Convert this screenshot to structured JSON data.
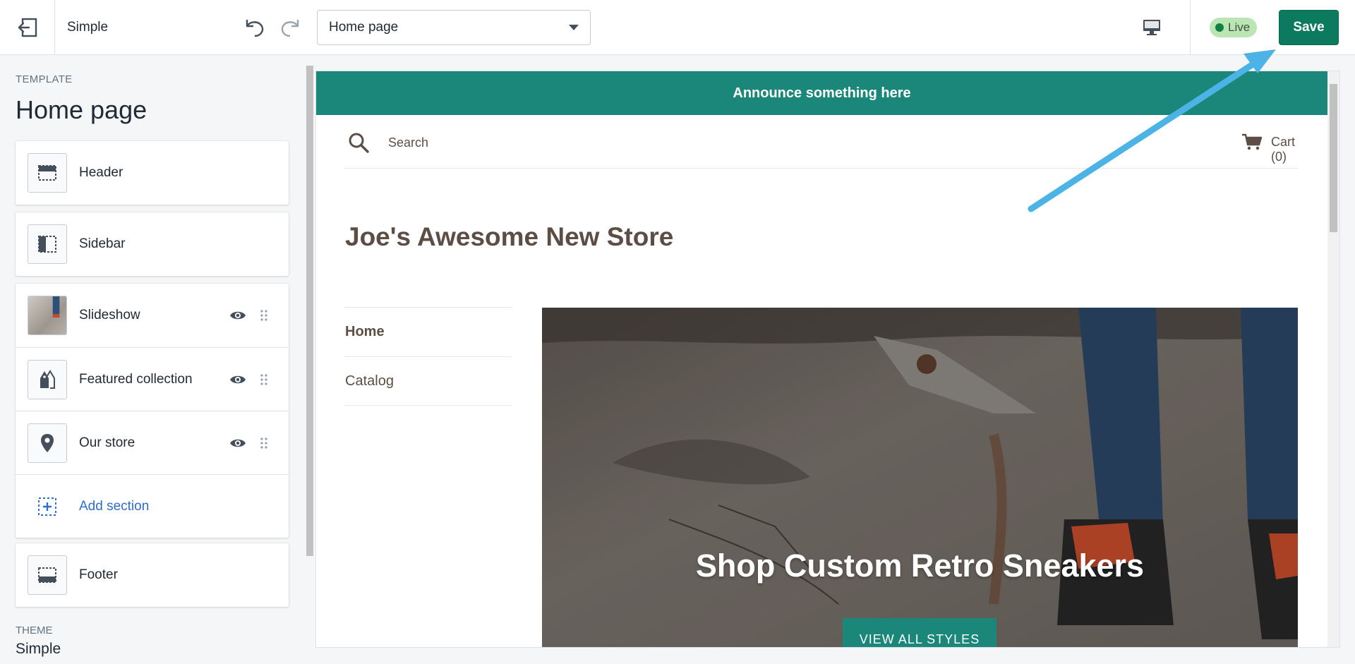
{
  "topbar": {
    "theme_name": "Simple",
    "page_select": "Home page",
    "live_label": "Live",
    "save_label": "Save"
  },
  "sidebar": {
    "template_label": "TEMPLATE",
    "title": "Home page",
    "sections": {
      "header": "Header",
      "sidebar": "Sidebar",
      "slideshow": "Slideshow",
      "featured_collection": "Featured collection",
      "our_store": "Our store",
      "add_section": "Add section",
      "footer": "Footer"
    },
    "theme_label": "THEME",
    "theme_name": "Simple"
  },
  "preview": {
    "announcement": "Announce something here",
    "search_label": "Search",
    "cart_label": "Cart (0)",
    "store_name": "Joe's Awesome New Store",
    "nav": [
      "Home",
      "Catalog"
    ],
    "hero_title": "Shop Custom Retro Sneakers",
    "hero_button": "VIEW ALL STYLES"
  },
  "colors": {
    "accent": "#1a877a",
    "save": "#0c7a5e",
    "link": "#2c6ecb",
    "annotation_arrow": "#4cb3e6"
  }
}
